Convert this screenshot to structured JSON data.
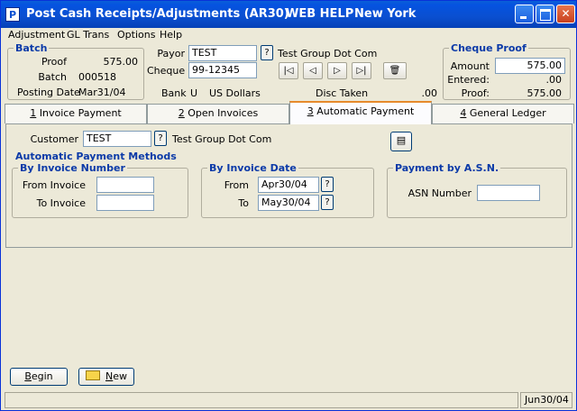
{
  "window": {
    "icon_letter": "P",
    "title": "Post Cash Receipts/Adjustments (AR30)",
    "help": "WEB HELP",
    "city": "New York"
  },
  "menu": [
    {
      "label": "Adjustment"
    },
    {
      "label": "GL Trans"
    },
    {
      "label": "Options"
    },
    {
      "label": "Help"
    }
  ],
  "batch": {
    "title": "Batch",
    "proof_label": "Proof",
    "proof_value": "575.00",
    "batch_label": "Batch",
    "batch_value": "000518",
    "posting_date_label": "Posting Date",
    "posting_date_value": "Mar31/04"
  },
  "payor": {
    "payor_label": "Payor",
    "payor_value": "TEST",
    "payor_name": "Test Group Dot Com",
    "cheque_label": "Cheque",
    "cheque_value": "99-12345",
    "bank_label": "Bank",
    "bank_code": "U",
    "bank_currency": "US Dollars",
    "disc_label": "Disc Taken",
    "disc_value": ".00"
  },
  "cheque_proof": {
    "title": "Cheque Proof",
    "amount_label": "Amount",
    "amount_value": "575.00",
    "entered_label": "Entered:",
    "entered_value": ".00",
    "proof_label": "Proof:",
    "proof_value": "575.00"
  },
  "tabs": [
    {
      "num": "1",
      "label": " Invoice Payment"
    },
    {
      "num": "2",
      "label": " Open Invoices"
    },
    {
      "num": "3",
      "label": " Automatic Payment"
    },
    {
      "num": "4",
      "label": " General Ledger"
    }
  ],
  "auto": {
    "customer_label": "Customer",
    "customer_value": "TEST",
    "customer_name": "Test Group Dot Com",
    "methods_title": "Automatic Payment Methods",
    "by_invoice_number": {
      "title": "By Invoice Number",
      "from_label": "From Invoice",
      "from_value": "",
      "to_label": "To Invoice",
      "to_value": ""
    },
    "by_invoice_date": {
      "title": "By Invoice Date",
      "from_label": "From",
      "from_value": "Apr30/04",
      "to_label": "To",
      "to_value": "May30/04"
    },
    "by_asn": {
      "title": "Payment by A.S.N.",
      "asn_label": "ASN Number",
      "asn_value": ""
    }
  },
  "buttons": {
    "begin_first": "B",
    "begin_rest": "egin",
    "new_first": "N",
    "new_rest": "ew"
  },
  "status": {
    "message": "",
    "date": "Jun30/04"
  },
  "colors": {
    "title_bar": "#0a4fd0",
    "group_title": "#0b3aa8",
    "active_tab_accent": "#e68b2c"
  },
  "icons": {
    "first": "first-record-icon",
    "prev": "previous-record-icon",
    "next": "next-record-icon",
    "last": "last-record-icon",
    "delete": "trash-icon",
    "print": "print-icon",
    "folder": "folder-icon"
  }
}
